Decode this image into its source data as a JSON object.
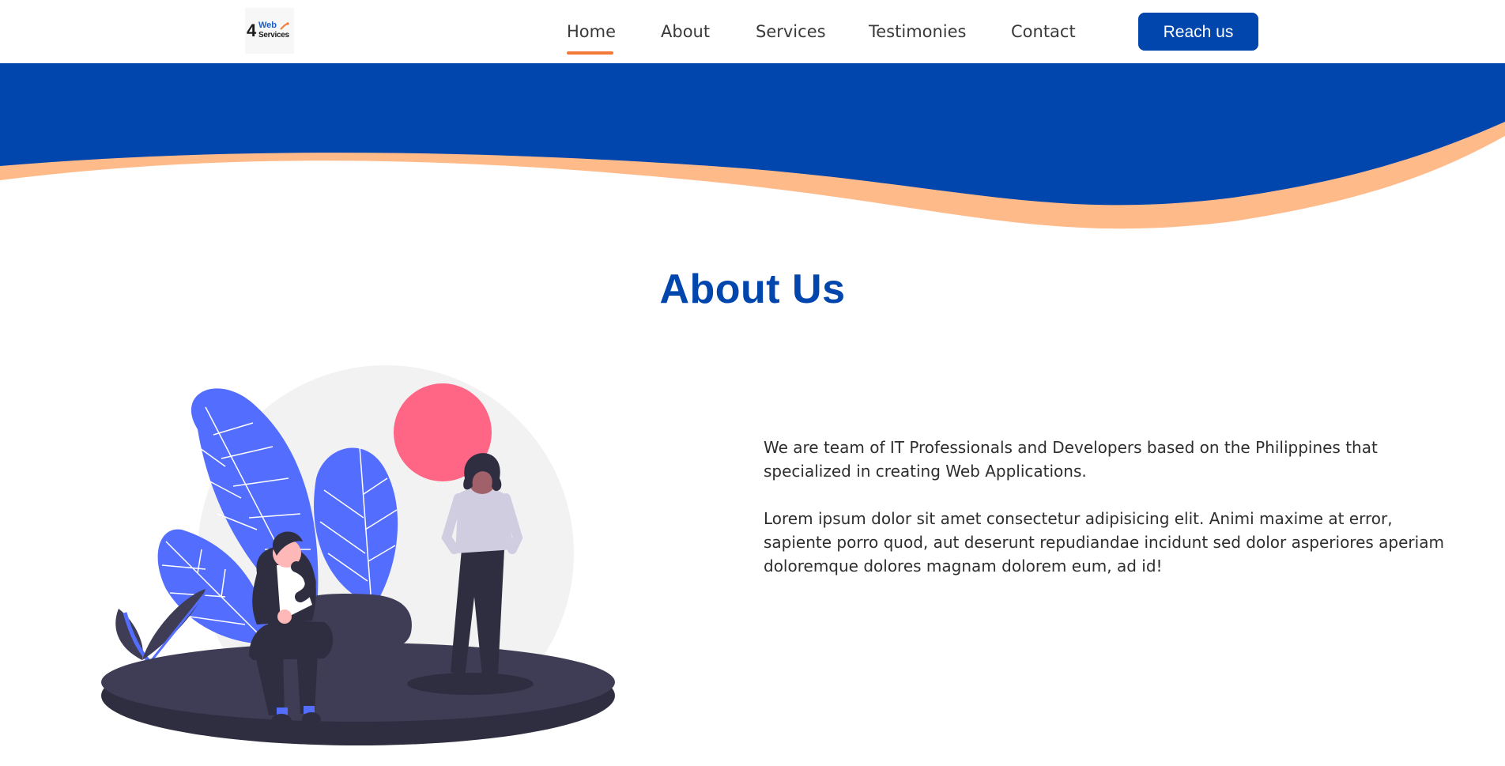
{
  "header": {
    "logo": {
      "number": "4",
      "line1": "Web",
      "line2": "Services"
    },
    "nav": [
      {
        "label": "Home",
        "active": true
      },
      {
        "label": "About",
        "active": false
      },
      {
        "label": "Services",
        "active": false
      },
      {
        "label": "Testimonies",
        "active": false
      },
      {
        "label": "Contact",
        "active": false
      }
    ],
    "cta_label": "Reach us"
  },
  "about": {
    "title": "About Us",
    "paragraphs": [
      "We are team of IT Professionals and Developers based on the Philippines that specialized in creating Web Applications.",
      "Lorem ipsum dolor sit amet consectetur adipisicing elit. Animi maxime at error, sapiente porro quod, aut deserunt repudiandae incidunt sed dolor asperiores aperiam doloremque dolores magnam dolorem eum, ad id!"
    ]
  },
  "colors": {
    "brand_blue": "#0046ad",
    "accent_orange": "#f37a36",
    "wave_peach": "#ffba8a",
    "sun_pink": "#ff6584",
    "leaf_blue": "#536dfe",
    "dark_ground": "#3f3d56"
  }
}
